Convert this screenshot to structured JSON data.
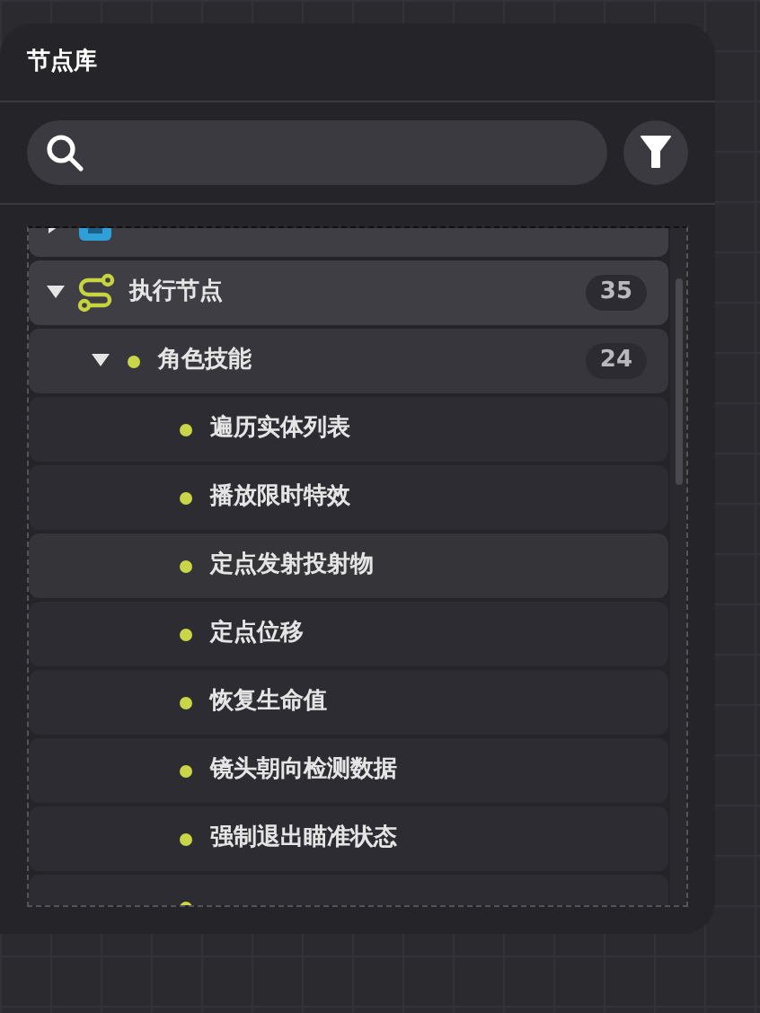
{
  "panel": {
    "title": "节点库"
  },
  "tree": [
    {
      "expanded": false,
      "kind": "select"
    },
    {
      "label": "执行节点",
      "count": "35",
      "expanded": true,
      "kind": "execute",
      "children": [
        {
          "label": "角色技能",
          "count": "24",
          "expanded": true,
          "children": [
            {
              "label": "遍历实体列表",
              "selected": false
            },
            {
              "label": "播放限时特效",
              "selected": false
            },
            {
              "label": "定点发射投射物",
              "selected": true
            },
            {
              "label": "定点位移",
              "selected": false
            },
            {
              "label": "恢复生命值",
              "selected": false
            },
            {
              "label": "镜头朝向检测数据",
              "selected": false
            },
            {
              "label": "强制退出瞄准状态",
              "selected": false
            },
            {
              "selected": false
            }
          ]
        }
      ]
    }
  ]
}
